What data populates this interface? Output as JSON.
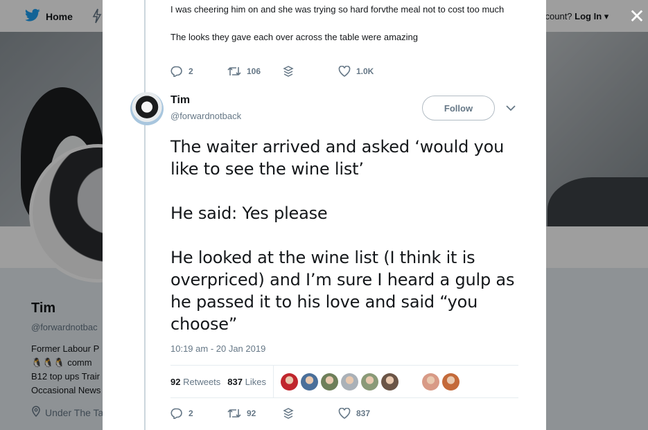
{
  "nav": {
    "home_label": "Home",
    "account_prompt": "ccount?",
    "login_label": "Log In",
    "close_glyph": "✕"
  },
  "background_profile": {
    "name": "Tim",
    "handle": "@forwardnotbac",
    "bio_line1": "Former Labour P",
    "bio_line2": "comm",
    "bio_line3": "B12 top ups Trair",
    "bio_line4": "Occasional News",
    "location": "Under The Ta"
  },
  "previous_tweet": {
    "lines": [
      "I was cheering him on and she was trying so hard forvthe meal not to cost too much",
      "The looks they gave each over across the table were amazing"
    ],
    "replies": "2",
    "retweets": "106",
    "likes": "1.0K"
  },
  "tweet": {
    "name": "Tim",
    "handle": "@forwardnotback",
    "follow_label": "Follow",
    "paragraphs": [
      "The waiter arrived and asked ‘would you like to see the wine list’",
      "He said: Yes please",
      "He looked at the wine list (I think it is overpriced) and I’m sure I heard a gulp as he passed it to his love and said “you choose”"
    ],
    "timestamp": "10:19 am - 20 Jan 2019",
    "retweets_count": "92",
    "retweets_label": "Retweets",
    "likes_count": "837",
    "likes_label": "Likes",
    "face_colors": [
      "#c0262d",
      "#4a6f9a",
      "#6e7f5a",
      "#aab1b8",
      "#8a9a78",
      "#6b5547",
      "#d89a86",
      "#c46a3a"
    ],
    "reply_count": "2",
    "retweet_action_count": "92",
    "like_action_count": "837"
  },
  "colors": {
    "accent": "#1da1f2",
    "text_primary": "#14171a",
    "text_secondary": "#657786"
  }
}
